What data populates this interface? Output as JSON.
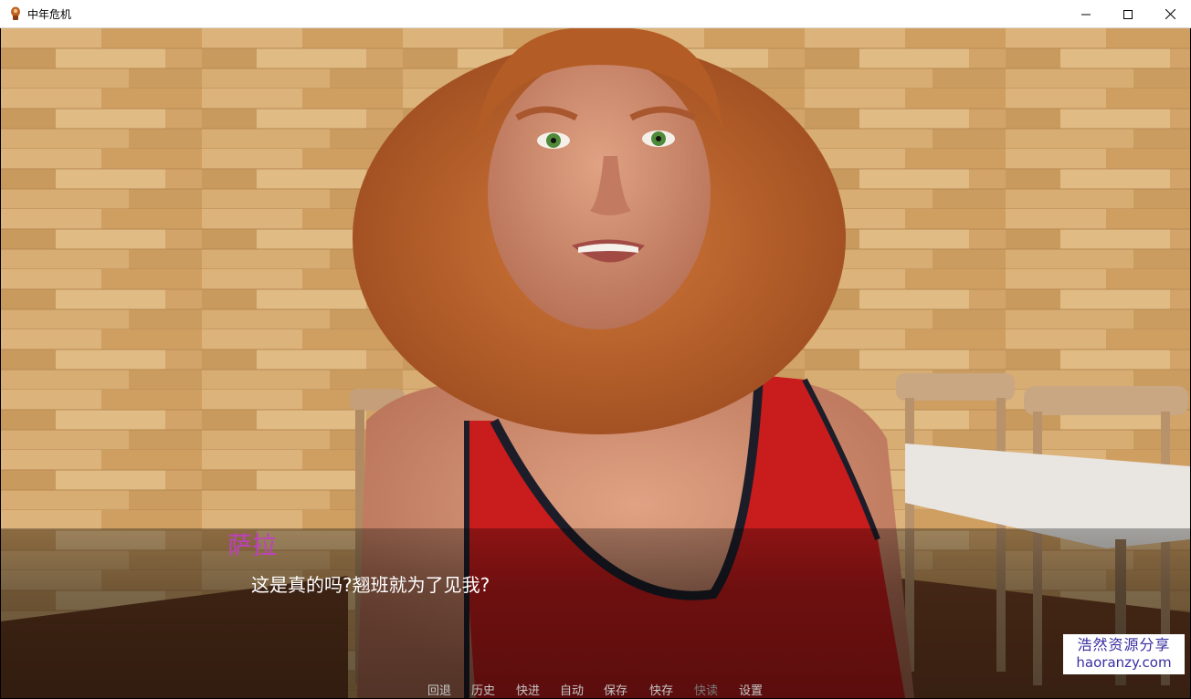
{
  "window": {
    "title": "中年危机"
  },
  "dialogue": {
    "speaker": "萨拉",
    "text": "这是真的吗?翘班就为了见我?",
    "speaker_color": "#c040c0"
  },
  "quick_menu": [
    {
      "label": "回退",
      "enabled": true
    },
    {
      "label": "历史",
      "enabled": true
    },
    {
      "label": "快进",
      "enabled": true
    },
    {
      "label": "自动",
      "enabled": true
    },
    {
      "label": "保存",
      "enabled": true
    },
    {
      "label": "快存",
      "enabled": true
    },
    {
      "label": "快读",
      "enabled": false
    },
    {
      "label": "设置",
      "enabled": true
    }
  ],
  "watermark": {
    "line1": "浩然资源分享",
    "line2": "haoranzy.com"
  }
}
